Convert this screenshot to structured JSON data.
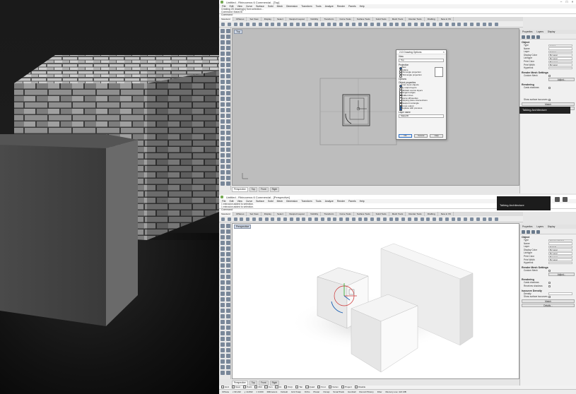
{
  "top_window": {
    "title": "Untitled - Rhinoceros 6 Commercial - [Top]",
    "menu": [
      "File",
      "Edit",
      "View",
      "Curve",
      "Surface",
      "Solid",
      "Mesh",
      "Dimension",
      "Transform",
      "Tools",
      "Analyze",
      "Render",
      "Panels",
      "Help"
    ],
    "command_history": [
      "Creating 2D drawing(s) from selection...",
      "Command: Make2D"
    ],
    "command_prompt": "Command:",
    "tabs": [
      "Standard",
      "CPlanes",
      "Set View",
      "Display",
      "Select",
      "Viewport Layout",
      "Visibility",
      "Transform",
      "Curve Tools",
      "Surface Tools",
      "Solid Tools",
      "Mesh Tools",
      "Render Tools",
      "Drafting",
      "New in V6"
    ],
    "viewport_label": "Top",
    "viewport_tabs": [
      "Perspective",
      "Top",
      "Front",
      "Right"
    ]
  },
  "bottom_window": {
    "title": "Untitled - Rhinoceros 6 Commercial - [Perspective]",
    "menu": [
      "File",
      "Edit",
      "View",
      "Curve",
      "Surface",
      "Solid",
      "Mesh",
      "Dimension",
      "Transform",
      "Tools",
      "Analyze",
      "Render",
      "Panels",
      "Help"
    ],
    "command_history": [
      "1 extrusion added to selection.",
      "1 extrusion added to selection."
    ],
    "command_prompt": "Command:",
    "tabs": [
      "Standard",
      "CPlanes",
      "Set View",
      "Display",
      "Select",
      "Viewport Layout",
      "Visibility",
      "Transform",
      "Curve Tools",
      "Surface Tools",
      "Solid Tools",
      "Mesh Tools",
      "Render Tools",
      "Drafting",
      "New in V6"
    ],
    "viewport_label": "Perspective",
    "viewport_tabs": [
      "Perspective",
      "Top",
      "Front",
      "Right"
    ]
  },
  "dialog": {
    "title": "2-D Drawing Options",
    "view_label": "View",
    "view_value": "Top",
    "projection_label": "Projection",
    "projection_options": [
      {
        "label": "View",
        "selected": true
      },
      {
        "label": "Cplane",
        "selected": false
      },
      {
        "label": "First angle projection",
        "selected": false
      },
      {
        "label": "Third angle projection",
        "selected": false
      }
    ],
    "options_label": "Options",
    "object_properties_label": "Object properties",
    "object_properties_options": [
      {
        "label": "From input objects",
        "selected": true
      },
      {
        "label": "By output layers",
        "selected": false
      },
      {
        "label": "Maintain source layers",
        "selected": false
      }
    ],
    "checkbox_options": [
      {
        "label": "Tangent edges",
        "checked": false
      },
      {
        "label": "Hidden lines",
        "checked": false
      },
      {
        "label": "Scene silhouettes",
        "checked": false
      },
      {
        "label": "Clipping plane intersections",
        "checked": false
      },
      {
        "label": "Viewport rectangle",
        "checked": false
      },
      {
        "label": "Group output",
        "checked": true
      },
      {
        "label": "Replace with previous",
        "checked": true
      }
    ],
    "layer_name_label": "Layer name",
    "layer_name_value": "Make2D",
    "ok": "OK",
    "cancel": "Cancel",
    "help": "Help"
  },
  "props_top": {
    "tabs": [
      "Properties",
      "Layers",
      "Display"
    ],
    "object_section": "Object",
    "rows": [
      {
        "label": "Type",
        "value": "curves"
      },
      {
        "label": "Name",
        "value": ""
      },
      {
        "label": "Layer",
        "value": "Curves"
      },
      {
        "label": "Display Color",
        "value": "By Layer"
      },
      {
        "label": "Linetype",
        "value": "By Layer"
      },
      {
        "label": "Print Color",
        "value": "By Layer"
      },
      {
        "label": "Print Width",
        "value": "By Layer"
      },
      {
        "label": "Hyperlink",
        "value": ""
      }
    ],
    "render_mesh_section": "Render Mesh Settings",
    "custom_mesh": "Custom Mesh",
    "adjust": "Adjust...",
    "rendering_section": "Rendering",
    "casts_shadows": "Casts shadows",
    "show_surface": "Show surface isocurves",
    "match": "Match",
    "details": "Details..."
  },
  "props_bot": {
    "tabs": [
      "Properties",
      "Layers",
      "Display"
    ],
    "object_section": "Object",
    "rows": [
      {
        "label": "Type",
        "value": "closed extrusion"
      },
      {
        "label": "Name",
        "value": ""
      },
      {
        "label": "Layer",
        "value": "Default"
      },
      {
        "label": "Display Color",
        "value": "By Layer"
      },
      {
        "label": "Linetype",
        "value": "By Layer"
      },
      {
        "label": "Print Color",
        "value": "By Layer"
      },
      {
        "label": "Print Width",
        "value": "By Layer"
      },
      {
        "label": "Hyperlink",
        "value": ""
      }
    ],
    "render_mesh_section": "Render Mesh Settings",
    "custom_mesh": "Custom Mesh",
    "adjust": "Adjust...",
    "rendering_section": "Rendering",
    "casts_shadows": "Casts shadows",
    "receives_shadows": "Receives shadows",
    "volume_section": "Isocurve Density",
    "density": "Density",
    "show_surface": "Show surface isocurves",
    "match": "Match",
    "details": "Details..."
  },
  "tooltip_top": "Talking Architecture",
  "tooltip_bottom": "Talking Architecture",
  "osnaps": [
    "End",
    "Near",
    "Point",
    "Mid",
    "Cen",
    "Int",
    "Perp",
    "Tan",
    "Quad",
    "Knot",
    "Vertex",
    "Project",
    "Disable"
  ],
  "status": [
    "CPlane",
    "x 90.222",
    "y 14.802",
    "z 0.000",
    "Millimeters",
    "Default",
    "Grid Snap",
    "Ortho",
    "Planar",
    "Osnap",
    "SmartTrack",
    "Gumball",
    "Record History",
    "Filter",
    "Memory use: 421 MB"
  ],
  "colors": {
    "viewport_top": "#bdbdbd",
    "viewport_bottom": "#ffffff",
    "selection": "#1a5fb4"
  }
}
